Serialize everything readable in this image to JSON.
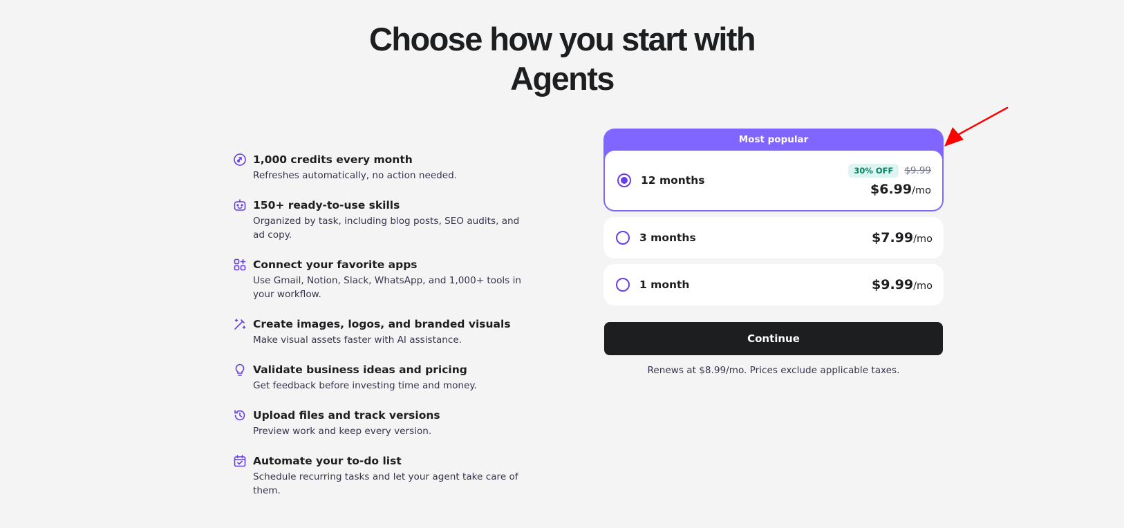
{
  "header": {
    "title_line1": "Choose how you start with",
    "title_line2": "Agents"
  },
  "features": [
    {
      "icon": "credits-icon",
      "title": "1,000 credits every month",
      "description": "Refreshes automatically, no action needed."
    },
    {
      "icon": "robot-icon",
      "title": "150+ ready-to-use skills",
      "description": "Organized by task, including blog posts, SEO audits, and ad copy."
    },
    {
      "icon": "apps-grid-icon",
      "title": "Connect your favorite apps",
      "description": "Use Gmail, Notion, Slack, WhatsApp, and 1,000+ tools in your workflow."
    },
    {
      "icon": "magic-wand-icon",
      "title": "Create images, logos, and branded visuals",
      "description": "Make visual assets faster with AI assistance."
    },
    {
      "icon": "lightbulb-icon",
      "title": "Validate business ideas and pricing",
      "description": "Get feedback before investing time and money."
    },
    {
      "icon": "history-icon",
      "title": "Upload files and track versions",
      "description": "Preview work and keep every version."
    },
    {
      "icon": "calendar-check-icon",
      "title": "Automate your to-do list",
      "description": "Schedule recurring tasks and let your agent take care of them."
    }
  ],
  "plans": {
    "popular_label": "Most popular",
    "items": [
      {
        "name": "12 months",
        "price": "$6.99",
        "unit": "/mo",
        "discount": "30% OFF",
        "old_price": "$9.99",
        "selected": true
      },
      {
        "name": "3 months",
        "price": "$7.99",
        "unit": "/mo",
        "selected": false
      },
      {
        "name": "1 month",
        "price": "$9.99",
        "unit": "/mo",
        "selected": false
      }
    ]
  },
  "actions": {
    "continue_label": "Continue",
    "renew_note": "Renews at $8.99/mo. Prices exclude applicable taxes."
  },
  "colors": {
    "accent": "#673de6",
    "popular_banner": "#8066ff",
    "button": "#1d1e20",
    "discount_bg": "#def4f0",
    "discount_text": "#008361",
    "annotation_arrow": "#ff0000",
    "background": "#f4f4f4"
  }
}
